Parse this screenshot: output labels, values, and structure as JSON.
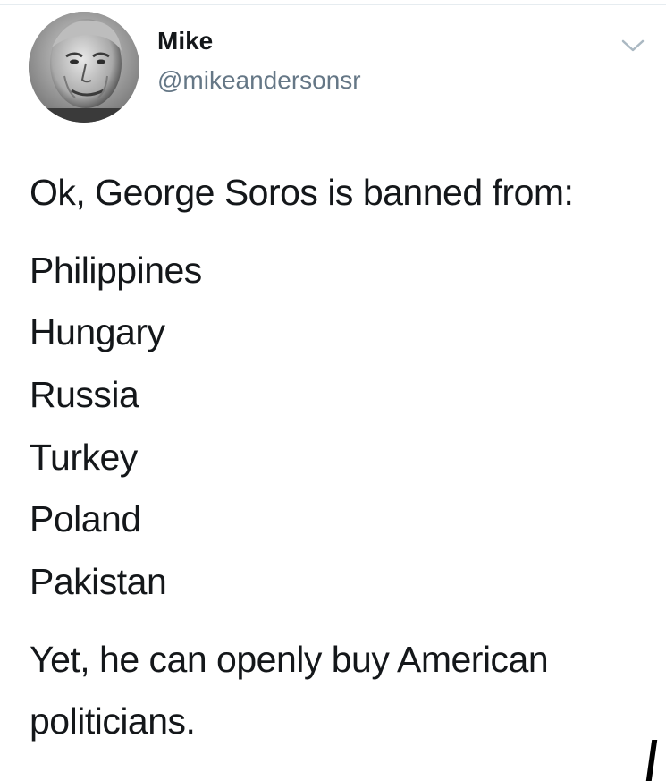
{
  "tweet": {
    "author": {
      "display_name": "Mike",
      "handle": "@mikeandersonsr",
      "avatar_icon": "avatar-photo"
    },
    "menu_icon": "chevron-down-icon",
    "intro": "Ok, George Soros is banned from:",
    "countries": [
      "Philippines",
      "Hungary",
      "Russia",
      "Turkey",
      "Poland",
      "Pakistan"
    ],
    "closing_lines": [
      "Yet, he can openly buy American",
      "politicians."
    ]
  },
  "colors": {
    "text": "#14171a",
    "secondary_text": "#657786",
    "divider": "#e6ecf0",
    "chevron": "#aab8c2"
  }
}
